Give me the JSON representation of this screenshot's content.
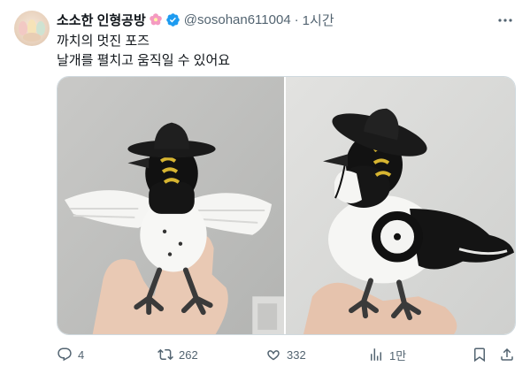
{
  "author": {
    "name": "소소한 인형공방",
    "handle": "@sosohan611004",
    "time": "1시간"
  },
  "tweet": {
    "line1": "까치의 멋진 포즈",
    "line2": "날개를 펼치고 움직일 수 있어요"
  },
  "stats": {
    "replies": "4",
    "reposts": "262",
    "likes": "332",
    "views": "1만"
  },
  "colors": {
    "text": "#0f1419",
    "secondary": "#536471",
    "verified": "#1d9bf0",
    "border": "#cfd9de"
  },
  "icons": [
    "flower-icon",
    "verified-badge-icon",
    "more-options-icon",
    "reply-icon",
    "repost-icon",
    "like-icon",
    "views-icon",
    "bookmark-icon",
    "share-icon"
  ]
}
